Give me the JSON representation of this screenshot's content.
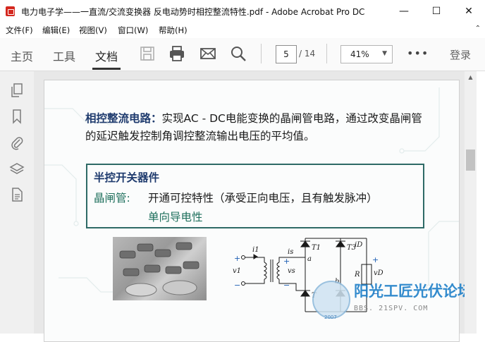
{
  "window": {
    "title": "电力电子学——一直流/交流变换器 反电动势时相控整流特性.pdf - Adobe Acrobat Pro DC",
    "minimize": "—",
    "maximize": "☐",
    "close": "✕"
  },
  "menu": [
    "文件(F)",
    "编辑(E)",
    "视图(V)",
    "窗口(W)",
    "帮助(H)"
  ],
  "menu_collapse": "⌃",
  "toolbar": {
    "tabs": [
      "主页",
      "工具",
      "文档"
    ],
    "page_current": "5",
    "page_total": "/ 14",
    "zoom": "41%",
    "more": "•••",
    "login": "登录",
    "icons": [
      "save-icon",
      "print-icon",
      "email-icon",
      "search-icon"
    ]
  },
  "left_pane_icons": [
    "pages-icon",
    "bookmark-icon",
    "attachment-icon",
    "layers-icon",
    "document-icon"
  ],
  "slide": {
    "p1_bold": "相控整流电路：",
    "p1_text": "实现AC - DC电能变换的晶闸管电路，通过改变晶闸管的延迟触发控制角调控整流输出电压的平均值。",
    "box_title": "半控开关器件",
    "box_l1_label": "晶闸管:",
    "box_l1_text": "开通可控特性（承受正向电压，且有触发脉冲）",
    "box_l2_text": "单向导电性",
    "circuit_labels": {
      "i1": "i1",
      "v1": "v1",
      "is": "is",
      "vs": "vs",
      "a": "a",
      "b": "b",
      "T1": "T1",
      "T3": "T3",
      "T2": "T",
      "iD": "iD",
      "R": "R",
      "vD": "vD",
      "plus": "+",
      "minus": "−"
    }
  },
  "watermark": {
    "main": "阳光工匠光伏论坛",
    "url": "BBS. 21SPV. COM",
    "year": "2007"
  },
  "colors": {
    "accent_box": "#2e6a66",
    "title_blue": "#1f3b6e",
    "teal_text": "#1e6f5c",
    "watermark_blue": "#1e7fc8"
  }
}
